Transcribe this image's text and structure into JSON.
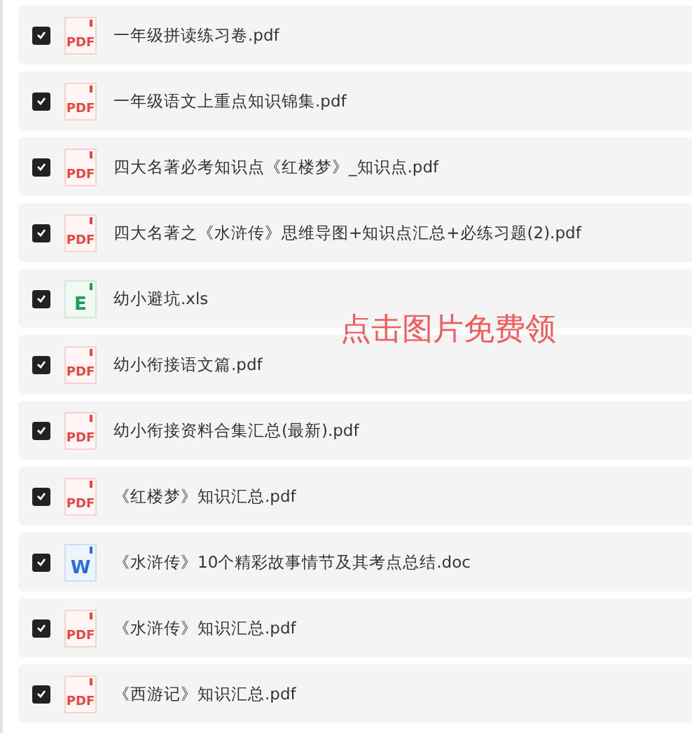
{
  "files": [
    {
      "name": "一年级拼读练习卷.pdf",
      "kind": "pdf",
      "icon_label": "PDF",
      "checked": true
    },
    {
      "name": "一年级语文上重点知识锦集.pdf",
      "kind": "pdf",
      "icon_label": "PDF",
      "checked": true
    },
    {
      "name": "四大名著必考知识点《红楼梦》_知识点.pdf",
      "kind": "pdf",
      "icon_label": "PDF",
      "checked": true
    },
    {
      "name": "四大名著之《水浒传》思维导图+知识点汇总+必练习题(2).pdf",
      "kind": "pdf",
      "icon_label": "PDF",
      "checked": true
    },
    {
      "name": "幼小避坑.xls",
      "kind": "xls",
      "icon_label": "E",
      "checked": true
    },
    {
      "name": "幼小衔接语文篇.pdf",
      "kind": "pdf",
      "icon_label": "PDF",
      "checked": true
    },
    {
      "name": "幼小衔接资料合集汇总(最新).pdf",
      "kind": "pdf",
      "icon_label": "PDF",
      "checked": true
    },
    {
      "name": "《红楼梦》知识汇总.pdf",
      "kind": "pdf",
      "icon_label": "PDF",
      "checked": true
    },
    {
      "name": "《水浒传》10个精彩故事情节及其考点总结.doc",
      "kind": "doc",
      "icon_label": "W",
      "checked": true
    },
    {
      "name": "《水浒传》知识汇总.pdf",
      "kind": "pdf",
      "icon_label": "PDF",
      "checked": true
    },
    {
      "name": "《西游记》知识汇总.pdf",
      "kind": "pdf",
      "icon_label": "PDF",
      "checked": true
    }
  ],
  "overlay_text": "点击图片免费领"
}
